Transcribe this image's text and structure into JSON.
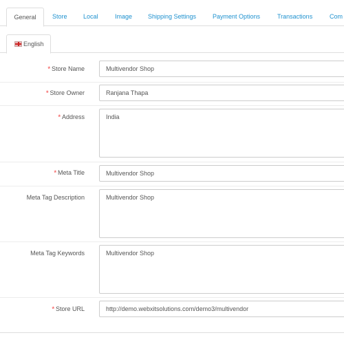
{
  "tabs": [
    {
      "label": "General",
      "active": true
    },
    {
      "label": "Store",
      "active": false
    },
    {
      "label": "Local",
      "active": false
    },
    {
      "label": "Image",
      "active": false
    },
    {
      "label": "Shipping Settings",
      "active": false
    },
    {
      "label": "Payment Options",
      "active": false
    },
    {
      "label": "Transactions",
      "active": false
    },
    {
      "label": "Com",
      "active": false
    }
  ],
  "language_tab": {
    "label": "English",
    "icon": "uk-flag-icon"
  },
  "form": {
    "store_name": {
      "label": "Store Name",
      "required": true,
      "value": "Multivendor Shop"
    },
    "store_owner": {
      "label": "Store Owner",
      "required": true,
      "value": "Ranjana Thapa"
    },
    "address": {
      "label": "Address",
      "required": true,
      "value": "India"
    },
    "meta_title": {
      "label": "Meta Title",
      "required": true,
      "value": "Multivendor Shop"
    },
    "meta_tag_description": {
      "label": "Meta Tag Description",
      "required": false,
      "value": "Multivendor Shop"
    },
    "meta_tag_keywords": {
      "label": "Meta Tag Keywords",
      "required": false,
      "value": "Multivendor Shop"
    },
    "store_url": {
      "label": "Store URL",
      "required": true,
      "value": "http://demo.webxitsolutions.com/demo3/multivendor"
    }
  },
  "colors": {
    "link": "#1e91cf",
    "required_star": "#f56b6b",
    "border": "#cccccc"
  }
}
